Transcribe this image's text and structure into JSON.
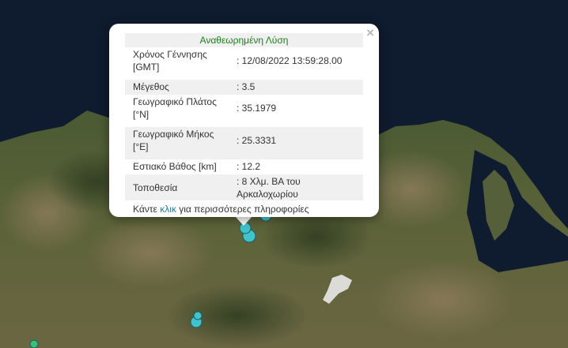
{
  "popup": {
    "title": "Αναθεωρημένη Λύση",
    "close_glyph": "×",
    "rows": [
      {
        "label": "Χρόνος Γέννησης [GMT]",
        "value": ": 12/08/2022 13:59:28.00"
      },
      {
        "label": "Μέγεθος",
        "value": ": 3.5"
      },
      {
        "label": "Γεωγραφικό Πλάτος [°N]",
        "value": ": 35.1979"
      },
      {
        "label": "Γεωγραφικό Μήκος [°E]",
        "value": ": 25.3331"
      },
      {
        "label": "Εστιακό Βάθος [km]",
        "value": ": 12.2"
      },
      {
        "label": "Τοποθεσία",
        "value": ": 8 Χλμ. ΒΑ του Αρκαλοχωρίου"
      }
    ],
    "footer": {
      "prefix": "Κάντε ",
      "link": "κλικ",
      "suffix": " για περισσότερες πληροφορίες"
    }
  },
  "colors": {
    "sea": "#0f1b2e",
    "marker_fill": "#41c3cc",
    "marker_stroke": "#1b5e63",
    "marker_green": "#3bbf74",
    "title_green": "#1a7f1a",
    "link": "#1a7fa8"
  },
  "markers": [
    {
      "name": "earthquake-marker-main",
      "color": "cyan",
      "size": "large"
    },
    {
      "name": "earthquake-marker-cluster",
      "color": "cyan",
      "size": "medium"
    },
    {
      "name": "earthquake-marker-east",
      "color": "cyan",
      "size": "medium"
    },
    {
      "name": "earthquake-marker-southwest",
      "color": "cyan",
      "size": "medium"
    },
    {
      "name": "earthquake-marker-southwest-small",
      "color": "cyan",
      "size": "small"
    },
    {
      "name": "earthquake-marker-bottom-left",
      "color": "green",
      "size": "small"
    }
  ]
}
